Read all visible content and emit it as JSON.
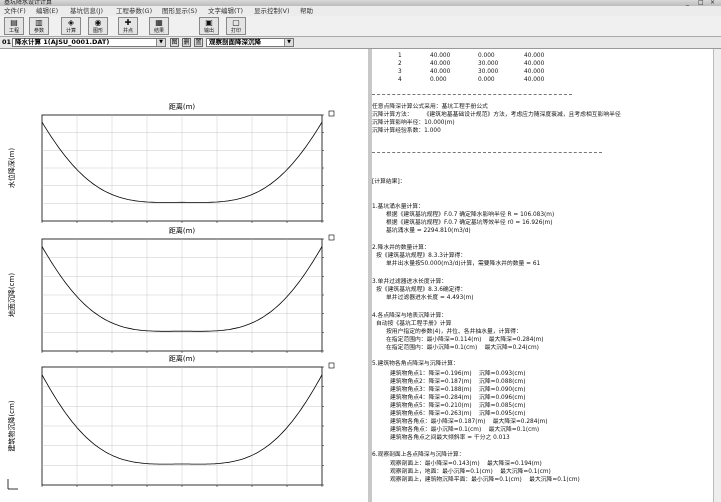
{
  "window": {
    "title": "基坑降水设计计算",
    "min": "_",
    "max": "□",
    "close": "×"
  },
  "menu": [
    "文件(F)",
    "编辑(E)",
    "基坑信息(J)",
    "工程参数(G)",
    "图形显示(S)",
    "文字编辑(T)",
    "显示控制(V)",
    "帮助"
  ],
  "toolbar": [
    {
      "icon": "▤",
      "label": "工程"
    },
    {
      "icon": "▥",
      "label": "参数"
    },
    {
      "icon": "◈",
      "label": "计算"
    },
    {
      "icon": "◉",
      "label": "图形"
    },
    {
      "icon": "✚",
      "label": "井点"
    },
    {
      "icon": "▦",
      "label": "结果"
    },
    {
      "icon": "▣",
      "label": "输出"
    },
    {
      "icon": "▢",
      "label": "打印"
    }
  ],
  "selector": {
    "prefix": "01",
    "project": "降水计算 1(AJSU_0001.DAT)",
    "btn1": "图",
    "btn2": "删",
    "btn3": "置",
    "mode": "观察剖面降深沉降"
  },
  "charts": [
    {
      "xlabel": "距离(m)",
      "ylabel": "水位降深(m)"
    },
    {
      "xlabel": "距离(m)",
      "ylabel": "地面沉降(cm)"
    },
    {
      "xlabel": "距离(m)",
      "ylabel": "建筑物沉降(cm)"
    }
  ],
  "report": {
    "table": [
      [
        "1",
        "40.000",
        "0.000",
        "40.000"
      ],
      [
        "2",
        "40.000",
        "30.000",
        "40.000"
      ],
      [
        "3",
        "40.000",
        "30.000",
        "40.000"
      ],
      [
        "4",
        "0.000",
        "0.000",
        "40.000"
      ]
    ],
    "lines": [
      "任意点降深计算公式采用：基坑工程手册公式",
      "沉降计算方法：      《建筑地基基础设计规范》方法，考虑应力随深度衰减，且考虑相互影响半径",
      "沉降计算影响半径：10.000(m)",
      "沉降计算经验系数：1.000",
      "[计算结果]：",
      "1.基坑涌水量计算：",
      "根据《建筑基坑规程》F.0.7 确定降水影响半径 R = 106.083(m)",
      "根据《建筑基坑规程》F.0.7 确定基坑等效半径 r0 = 16.926(m)",
      "基坑涌水量 = 2294.810(m3/d)",
      "2.降水井的数量计算：",
      "按《建筑基坑规程》8.3.3计算得：",
      "单井出水量按50.000(m3/d)计算，需要降水井的数量 = 61",
      "3.单井过滤器进水长度计算：",
      "按《建筑基坑规程》8.3.6确定得：",
      "单井过滤器进水长度 = 4.493(m)",
      "4.各点降深与地表沉降计算：",
      "自动按《基坑工程手册》计算",
      "按用户指定的参数(4)，井位、各井抽水量，计算得：",
      "在指定范围内：最小降深=0.114(m)    最大降深=0.284(m)",
      "在指定范围内：最小沉降=0.1(cm)    最大沉降=0.24(cm)",
      "5.建筑物各角点降深与沉降计算：",
      "建筑物角点1：降深=0.196(m)    沉降=0.093(cm)",
      "建筑物角点2：降深=0.187(m)    沉降=0.088(cm)",
      "建筑物角点3：降深=0.188(m)    沉降=0.090(cm)",
      "建筑物角点4：降深=0.284(m)    沉降=0.096(cm)",
      "建筑物角点5：降深=0.210(m)    沉降=0.085(cm)",
      "建筑物角点6：降深=0.263(m)    沉降=0.095(cm)",
      "建筑物各角点：最小降深=0.187(m)    最大降深=0.284(m)",
      "建筑物各角点：最小沉降=0.1(cm)    最大沉降=0.1(cm)",
      "建筑物各角点之间最大倾斜率 = 千分之 0.013",
      "6.观察剖面上各点降深与沉降计算：",
      "观察剖面上：最小降深=0.143(m)    最大降深=0.194(m)",
      "观察剖面上，地面：最小沉降=0.1(cm)    最大沉降=0.1(cm)",
      "观察剖面上，建筑物沉降平面：最小沉降=0.1(cm)    最大沉降=0.1(cm)"
    ]
  }
}
